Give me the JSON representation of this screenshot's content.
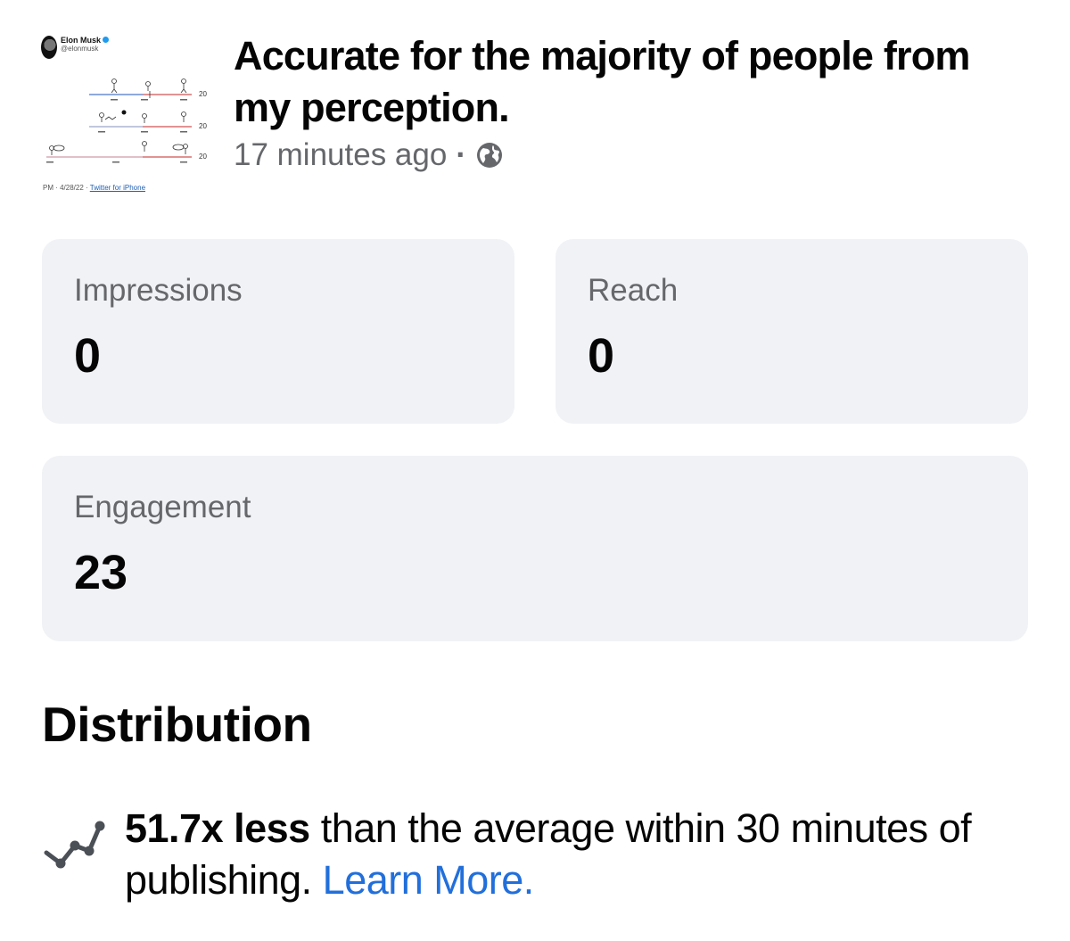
{
  "post": {
    "thumbnail": {
      "author_name": "Elon Musk",
      "author_handle": "@elonmusk",
      "scale_labels": [
        "20",
        "20",
        "20"
      ],
      "meta_prefix": "PM · 4/28/22 · ",
      "meta_source": "Twitter for iPhone"
    },
    "title": "Accurate for the majority of people from my perception.",
    "time": "17 minutes ago",
    "separator": "·",
    "privacy_icon": "globe-icon"
  },
  "metrics": {
    "impressions": {
      "label": "Impressions",
      "value": "0"
    },
    "reach": {
      "label": "Reach",
      "value": "0"
    },
    "engagement": {
      "label": "Engagement",
      "value": "23"
    }
  },
  "distribution": {
    "title": "Distribution",
    "icon": "trend-line-icon",
    "strong_text": "51.7x less",
    "text": " than the average within 30 minutes of publishing. ",
    "link_text": "Learn More."
  },
  "colors": {
    "card_background": "#f0f2f5",
    "secondary_text": "#65676b",
    "link": "#216fdb",
    "primary_text": "#050505"
  }
}
